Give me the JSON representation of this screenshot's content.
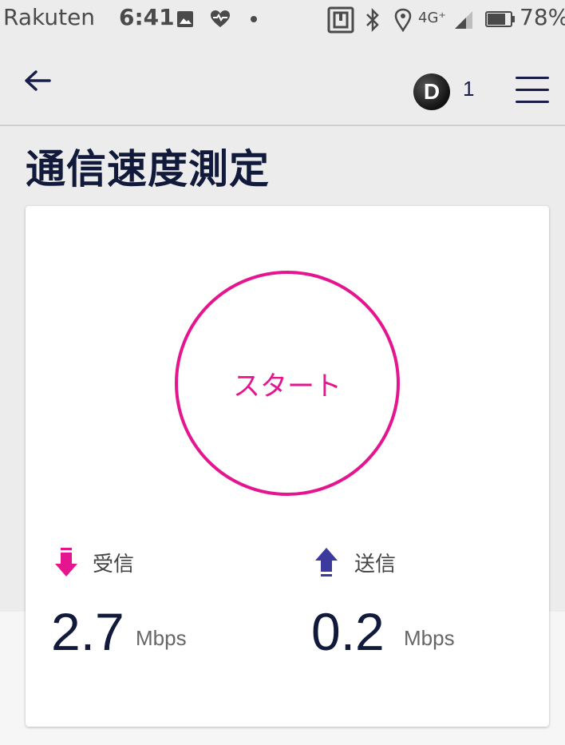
{
  "status_bar": {
    "carrier": "Rakuten",
    "time": "6:41",
    "network": "4G⁺",
    "battery": "78%"
  },
  "app_bar": {
    "badge_letter": "D",
    "badge_count": "1"
  },
  "page": {
    "title": "通信速度測定"
  },
  "speed_test": {
    "start_label": "スタート",
    "download": {
      "label": "受信",
      "value": "2.7",
      "unit": "Mbps",
      "color": "#e5158f"
    },
    "upload": {
      "label": "送信",
      "value": "0.2",
      "unit": "Mbps",
      "color": "#3d3a9e"
    }
  },
  "icons": [
    "image-icon",
    "heart-pulse-icon",
    "dot-icon",
    "nfc-icon",
    "bluetooth-icon",
    "location-icon",
    "signal-icon",
    "battery-icon",
    "back-arrow-icon",
    "menu-icon",
    "download-arrow-icon",
    "upload-arrow-icon"
  ]
}
